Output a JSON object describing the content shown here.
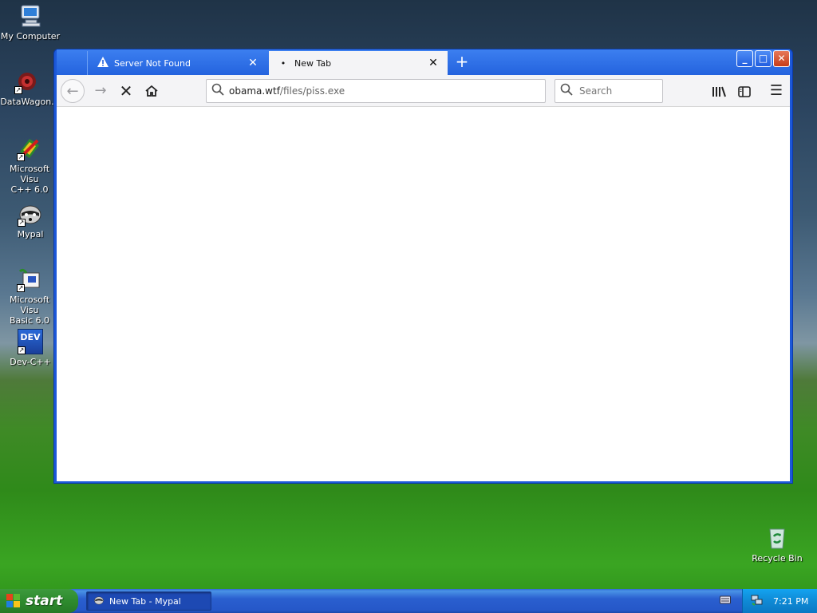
{
  "desktop": {
    "icons": [
      {
        "name": "my-computer",
        "label": "My Computer"
      },
      {
        "name": "datawagon",
        "label": "DataWagon."
      },
      {
        "name": "msvc",
        "label": "Microsoft Visu\nC++ 6.0"
      },
      {
        "name": "mypal",
        "label": "Mypal"
      },
      {
        "name": "msvb",
        "label": "Microsoft Visu\nBasic 6.0"
      },
      {
        "name": "devcpp",
        "label": "Dev-C++"
      },
      {
        "name": "recycle-bin",
        "label": "Recycle Bin"
      }
    ],
    "devcpp_glyph_text": "DEV"
  },
  "browser": {
    "tabs": [
      {
        "title": "Server Not Found",
        "icon": "warning-icon",
        "active": false
      },
      {
        "title": "New Tab",
        "icon": "loading-dot-icon",
        "active": true
      }
    ],
    "new_tab_glyph": "+",
    "url": {
      "host": "obama.wtf",
      "path": "/files/piss.exe"
    },
    "search_placeholder": "Search"
  },
  "taskbar": {
    "start_label": "start",
    "task_item_label": "New Tab - Mypal",
    "clock": "7:21 PM"
  },
  "colors": {
    "titlebar": "#2463de",
    "start_green": "#2e8b2e",
    "tray_blue": "#0f8ad5"
  }
}
